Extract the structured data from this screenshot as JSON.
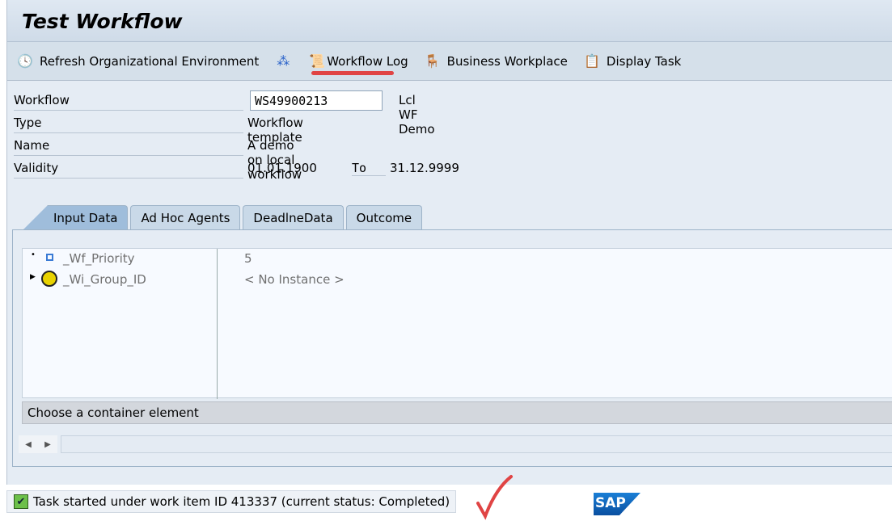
{
  "title": "Test Workflow",
  "toolbar": {
    "refresh": "Refresh Organizational Environment",
    "workflow_log": "Workflow Log",
    "business_workplace": "Business Workplace",
    "display_task": "Display Task"
  },
  "form": {
    "workflow_label": "Workflow",
    "workflow_value": "WS49900213",
    "workflow_desc": "Lcl WF Demo",
    "type_label": "Type",
    "type_value": "Workflow template",
    "name_label": "Name",
    "name_value": "A demo on local workflow",
    "validity_label": "Validity",
    "valid_from": "01.01.1900",
    "to_label": "To",
    "valid_to": "31.12.9999"
  },
  "tabs": [
    "Input Data",
    "Ad Hoc Agents",
    "DeadlneData",
    "Outcome"
  ],
  "tree": [
    {
      "name": "_Wf_Priority",
      "value": "5"
    },
    {
      "name": "_Wi_Group_ID",
      "value": "< No Instance >"
    }
  ],
  "choose": "Choose a container element",
  "status": "Task started under work item ID 413337 (current status: Completed)",
  "logo": "SAP"
}
